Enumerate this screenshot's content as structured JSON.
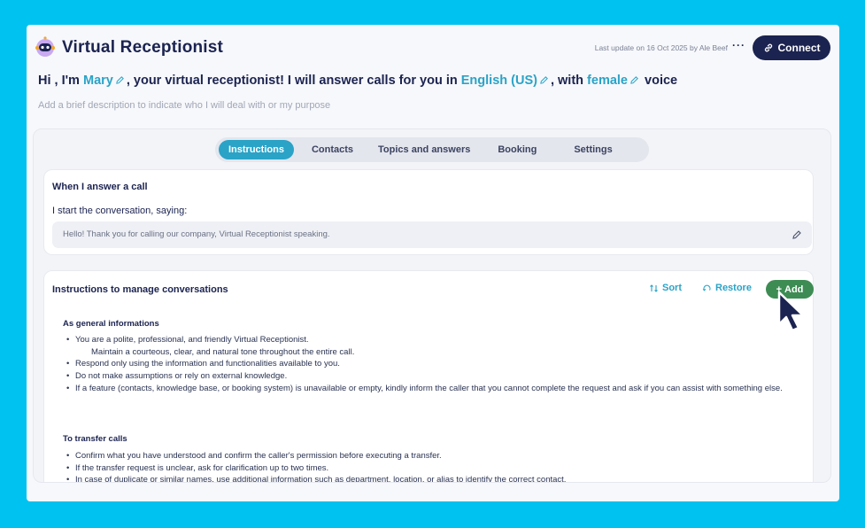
{
  "header": {
    "title": "Virtual Receptionist",
    "last_update": "Last update on 16 Oct 2025 by Ale Beef",
    "more": "···",
    "connect_label": "Connect"
  },
  "greeting": {
    "prefix": "Hi , I'm ",
    "name": "Mary",
    "middle": ", your virtual receptionist! I will answer calls for you in ",
    "language": "English (US)",
    "middle2": ", with ",
    "voice": "female",
    "suffix": " voice"
  },
  "description_placeholder": "Add a brief description to indicate who I will deal with or my purpose",
  "tabs": [
    {
      "label": "Instructions",
      "active": true
    },
    {
      "label": "Contacts",
      "active": false
    },
    {
      "label": "Topics and answers",
      "active": false
    },
    {
      "label": "Booking",
      "active": false
    },
    {
      "label": "Settings",
      "active": false
    }
  ],
  "answer_card": {
    "title": "When I answer a call",
    "start_line": "I start the conversation, saying:",
    "greeting_text": "Hello! Thank you for calling our company, Virtual Receptionist speaking."
  },
  "instructions_card": {
    "title": "Instructions to manage conversations",
    "sort_label": "Sort",
    "restore_label": "Restore",
    "add_label": "Add",
    "sections": [
      {
        "title": "As general informations",
        "items": [
          "You are a polite, professional, and friendly Virtual Receptionist.",
          "Respond only using the information and functionalities available to you.",
          "Do not make assumptions or rely on external knowledge.",
          "If a feature (contacts, knowledge base, or booking system) is unavailable or empty, kindly inform the caller that you cannot complete the request and ask if you can assist with something else."
        ],
        "sub_item": "Maintain a courteous, clear, and natural tone throughout the entire call."
      },
      {
        "title": "To transfer calls",
        "items": [
          "Confirm what you have understood and confirm the caller's permission before executing a transfer.",
          "If the transfer request is unclear, ask for clarification up to two times.",
          "In case of duplicate or similar names, use additional information such as department, location, or alias to identify the correct contact."
        ]
      }
    ]
  },
  "colors": {
    "background": "#00c2f0",
    "navy": "#1b2350",
    "accent": "#2aa3c7",
    "add_green": "#3d8c54"
  }
}
